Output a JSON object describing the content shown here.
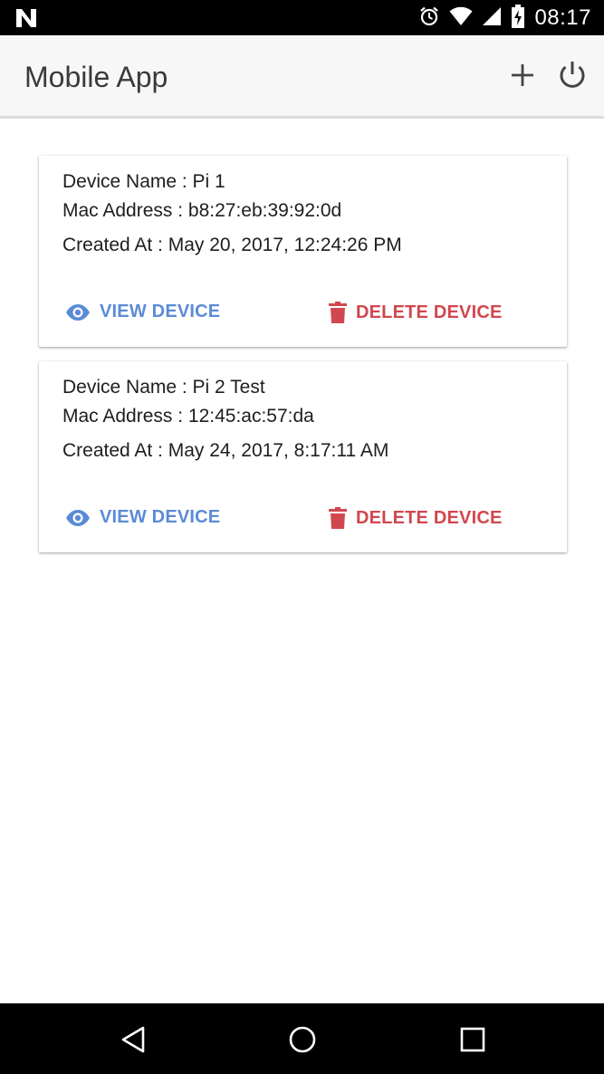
{
  "status_bar": {
    "time": "08:17",
    "icons": [
      "notification-n-icon",
      "alarm-icon",
      "wifi-icon",
      "signal-icon",
      "battery-charging-icon"
    ]
  },
  "app_bar": {
    "title": "Mobile App",
    "actions": [
      "add-icon",
      "power-icon"
    ]
  },
  "devices": [
    {
      "name_line": "Device Name : Pi 1",
      "mac_line": "Mac Address : b8:27:eb:39:92:0d",
      "created_line": "Created At : May 20, 2017, 12:24:26 PM",
      "view_label": "VIEW DEVICE",
      "delete_label": "DELETE DEVICE"
    },
    {
      "name_line": "Device Name : Pi 2 Test",
      "mac_line": "Mac Address : 12:45:ac:57:da",
      "created_line": "Created At : May 24, 2017, 8:17:11 AM",
      "view_label": "VIEW DEVICE",
      "delete_label": "DELETE DEVICE"
    }
  ],
  "colors": {
    "view_action": "#5b8bd6",
    "delete_action": "#d1474f",
    "app_bar_bg": "#f7f7f7",
    "status_bar_bg": "#000000"
  },
  "nav_bar": {
    "icons": [
      "back-icon",
      "home-icon",
      "recents-icon"
    ]
  }
}
